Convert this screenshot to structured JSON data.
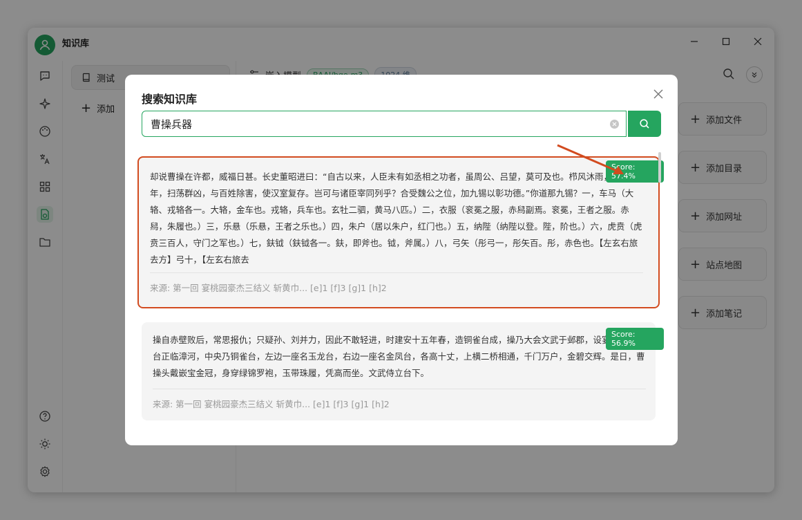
{
  "app": {
    "title": "知识库"
  },
  "panel": {
    "kb_item_label": "测试",
    "add_label": "添加"
  },
  "header": {
    "embed_label": "嵌入模型",
    "model_tag": "BAAI/bge-m3",
    "dim_tag": "1024 维"
  },
  "actions": [
    "添加文件",
    "添加目录",
    "添加网址",
    "站点地图",
    "添加笔记"
  ],
  "modal": {
    "title": "搜索知识库",
    "search_value": "曹操兵器",
    "results": [
      {
        "score": "Score: 57.4%",
        "text": "却说曹操在许都，威福日甚。长史董昭进曰：“自古以来，人臣未有如丞相之功者，虽周公、吕望，莫可及也。栉风沐雨，三十余年，扫荡群凶，与百姓除害，使汉室复存。岂可与诸臣宰同列乎？合受魏公之位，加九锡以彰功德。”你道那九锡？一，车马（大辂、戎辂各一。大辂，金车也。戎辂，兵车也。玄牡二驷，黄马八匹。）二，衣服（衮冕之服，赤舄副焉。衮冕，王者之服。赤舄，朱履也。）三，乐悬（乐悬，王者之乐也。）四，朱户（居以朱户，红门也。）五，纳陛（纳陛以登。陛，阶也。）六，虎贲（虎贲三百人，守门之军也。）七，鈇钺（鈇钺各一。鈇，即斧也。钺，斧属。）八，弓矢（彤弓一，彤矢百。彤，赤色也。【左玄右旅去方】弓十，【左玄右旅去",
        "source": "来源: 第一回 宴桃园豪杰三结义 斩黄巾... [e]1 [f]3 [g]1 [h]2"
      },
      {
        "score": "Score: 56.9%",
        "text": "操自赤壁败后，常思报仇；只疑孙、刘并力，因此不敢轻进，时建安十五年春，造铜雀台成，操乃大会文武于邺郡，设宴庆贺。其台正临漳河，中央乃铜雀台，左边一座名玉龙台，右边一座名金凤台，各高十丈，上横二桥相通，千门万户，金碧交辉。是日，曹操头戴嵌宝金冠，身穿绿锦罗袍，玉带珠履，凭高而坐。文武侍立台下。",
        "source": "来源: 第一回 宴桃园豪杰三结义 斩黄巾... [e]1 [f]3 [g]1 [h]2"
      }
    ]
  },
  "colors": {
    "accent": "#25a55f",
    "highlight": "#d24b1f"
  }
}
